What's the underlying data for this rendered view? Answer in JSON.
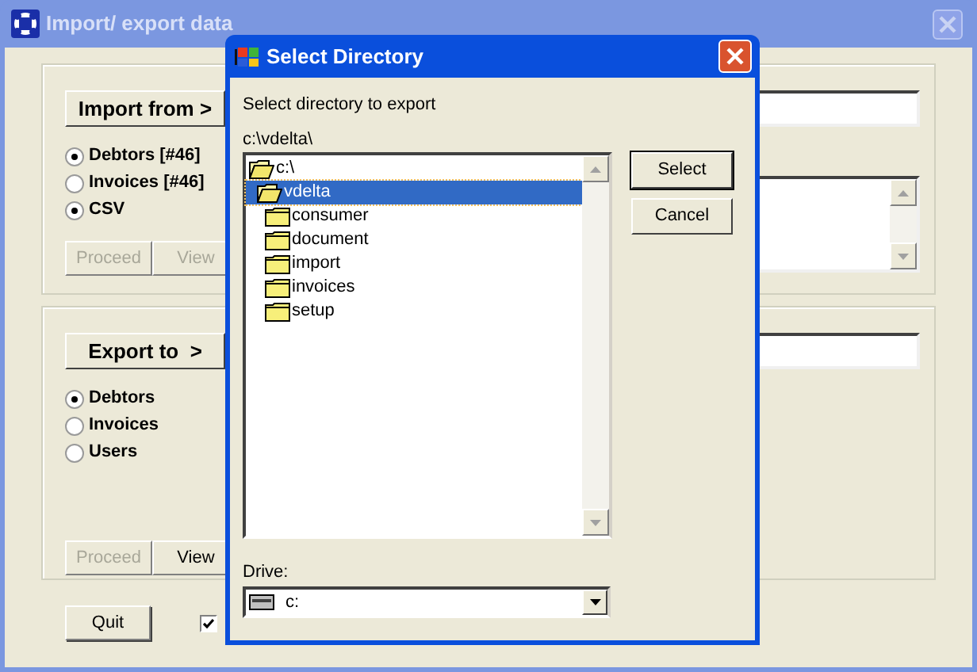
{
  "main_window": {
    "title": "Import/ export data",
    "import_panel": {
      "button": "Import from >",
      "options": [
        {
          "label": "Debtors [#46]",
          "selected": true
        },
        {
          "label": "Invoices [#46]",
          "selected": false
        },
        {
          "label": "CSV",
          "selected": true
        }
      ],
      "actions": [
        {
          "label": "Proceed",
          "disabled": true
        },
        {
          "label": "View",
          "disabled": true
        }
      ]
    },
    "export_panel": {
      "button": "Export to  >",
      "options": [
        {
          "label": "Debtors",
          "selected": true
        },
        {
          "label": "Invoices",
          "selected": false
        },
        {
          "label": "Users",
          "selected": false
        }
      ],
      "actions": [
        {
          "label": "Proceed",
          "disabled": true
        },
        {
          "label": "View",
          "disabled": false
        }
      ]
    },
    "quit_button": "Quit",
    "checkbox": {
      "checked": true
    }
  },
  "dialog": {
    "title": "Select Directory",
    "prompt": "Select directory to export",
    "path": "c:\\vdelta\\",
    "tree": [
      {
        "label": "c:\\",
        "expanded": true,
        "selected": false,
        "children": [
          {
            "label": "vdelta",
            "expanded": true,
            "selected": true,
            "children": [
              {
                "label": "consumer",
                "expanded": false,
                "selected": false
              },
              {
                "label": "document",
                "expanded": false,
                "selected": false
              },
              {
                "label": "import",
                "expanded": false,
                "selected": false
              },
              {
                "label": "invoices",
                "expanded": false,
                "selected": false
              },
              {
                "label": "setup",
                "expanded": false,
                "selected": false
              }
            ]
          }
        ]
      }
    ],
    "buttons": [
      "Select",
      "Cancel"
    ],
    "drive_label": "Drive:",
    "drive": "c:"
  }
}
